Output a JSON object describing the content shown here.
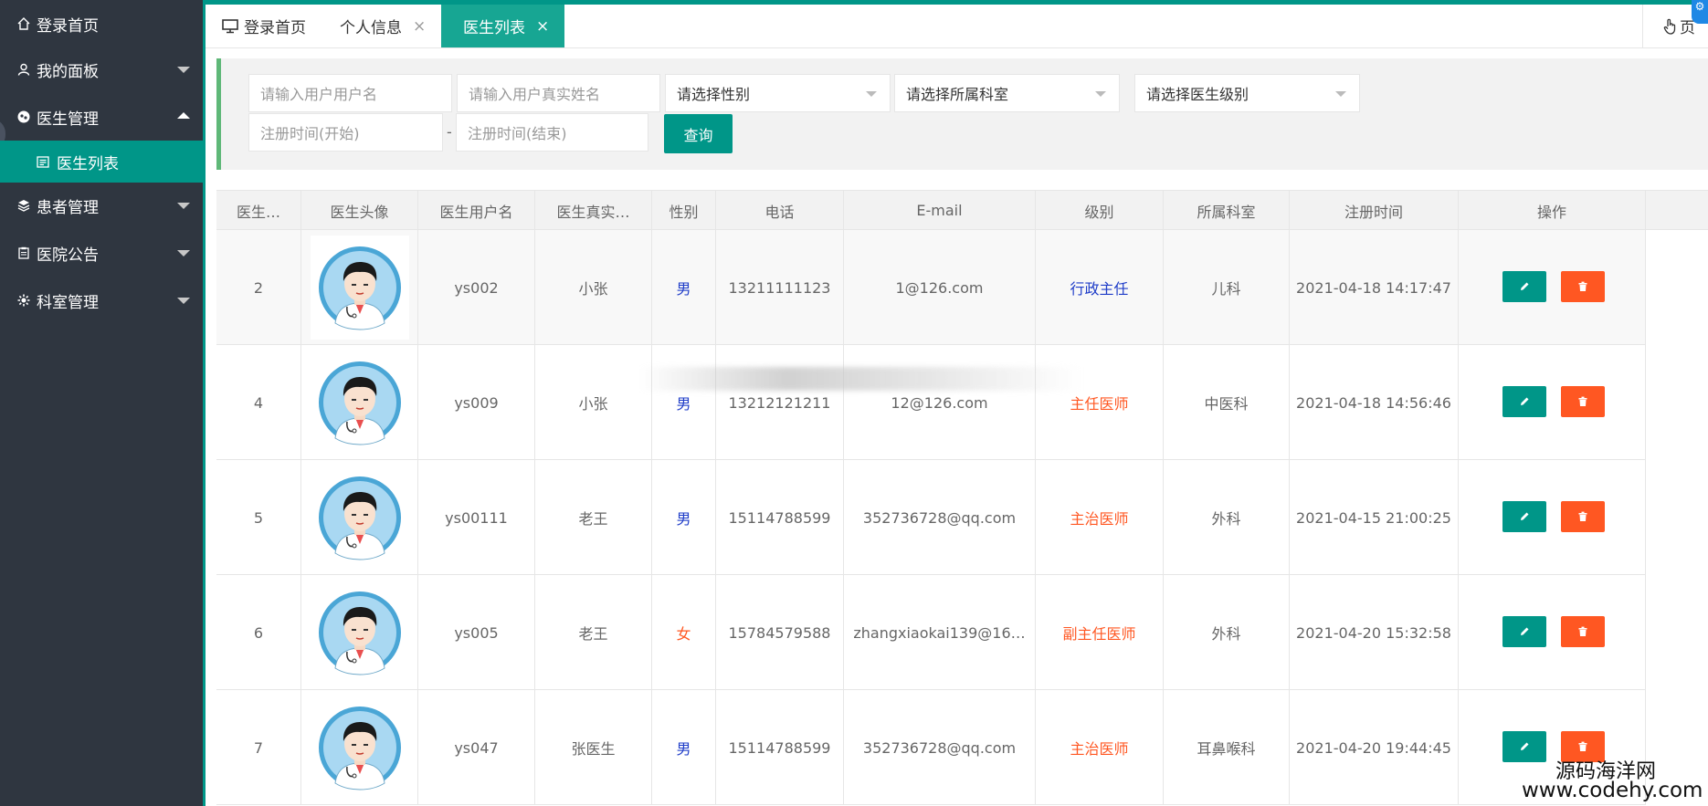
{
  "sidebar": {
    "items": [
      {
        "label": "登录首页",
        "icon": "home-icon"
      },
      {
        "label": "我的面板",
        "icon": "user-icon"
      },
      {
        "label": "医生管理",
        "icon": "doctor-icon"
      },
      {
        "label": "患者管理",
        "icon": "layers-icon"
      },
      {
        "label": "医院公告",
        "icon": "notice-icon"
      },
      {
        "label": "科室管理",
        "icon": "gear-icon"
      }
    ],
    "sub_item": {
      "label": "医生列表",
      "icon": "list-icon"
    }
  },
  "tabs": [
    {
      "label": "登录首页",
      "icon": "monitor-icon"
    },
    {
      "label": "个人信息",
      "close": "×"
    },
    {
      "label": "医生列表",
      "close": "×"
    }
  ],
  "tab_right": {
    "label": "页",
    "icon": "hand-icon"
  },
  "filter": {
    "username_placeholder": "请输入用户用户名",
    "realname_placeholder": "请输入用户真实姓名",
    "gender_select": "请选择性别",
    "dept_select": "请选择所属科室",
    "level_select": "请选择医生级别",
    "start_placeholder": "注册时间(开始)",
    "end_placeholder": "注册时间(结束)",
    "range_sep": "-",
    "query_label": "查询"
  },
  "table": {
    "headers": [
      "医生…",
      "医生头像",
      "医生用户名",
      "医生真实…",
      "性别",
      "电话",
      "E-mail",
      "级别",
      "所属科室",
      "注册时间",
      "操作"
    ],
    "rows": [
      {
        "id": "2",
        "username": "ys002",
        "realname": "小张",
        "gender": "男",
        "phone": "13211111123",
        "email": "1@126.com",
        "level": "行政主任",
        "dept": "儿科",
        "time": "2021-04-18 14:17:47"
      },
      {
        "id": "4",
        "username": "ys009",
        "realname": "小张",
        "gender": "男",
        "phone": "13212121211",
        "email": "12@126.com",
        "level": "主任医师",
        "dept": "中医科",
        "time": "2021-04-18 14:56:46"
      },
      {
        "id": "5",
        "username": "ys00111",
        "realname": "老王",
        "gender": "男",
        "phone": "15114788599",
        "email": "352736728@qq.com",
        "level": "主治医师",
        "dept": "外科",
        "time": "2021-04-15 21:00:25"
      },
      {
        "id": "6",
        "username": "ys005",
        "realname": "老王",
        "gender": "女",
        "phone": "15784579588",
        "email": "zhangxiaokai139@16…",
        "level": "副主任医师",
        "dept": "外科",
        "time": "2021-04-20 15:32:58"
      },
      {
        "id": "7",
        "username": "ys047",
        "realname": "张医生",
        "gender": "男",
        "phone": "15114788599",
        "email": "352736728@qq.com",
        "level": "主治医师",
        "dept": "耳鼻喉科",
        "time": "2021-04-20 19:44:45"
      }
    ]
  },
  "watermark": {
    "line1": "源码海洋网",
    "line2": "www.codehy.com"
  },
  "colors": {
    "accent": "#009688",
    "sidebar": "#2f3640",
    "male": "#1e3cc8",
    "female": "#ff5722",
    "delete": "#ff5722"
  }
}
